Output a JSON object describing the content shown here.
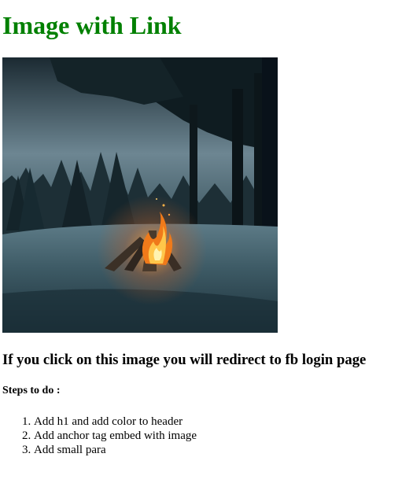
{
  "header": {
    "title": "Image with Link",
    "title_color": "#008000"
  },
  "image_link": {
    "image_description_icon": "campfire-snow-forest-photo"
  },
  "caption": "If you click on this image you will redirect to fb login page",
  "steps": {
    "heading": "Steps to do :",
    "items": [
      "Add h1 and add color to header",
      "Add anchor tag embed with image",
      "Add small para"
    ]
  }
}
